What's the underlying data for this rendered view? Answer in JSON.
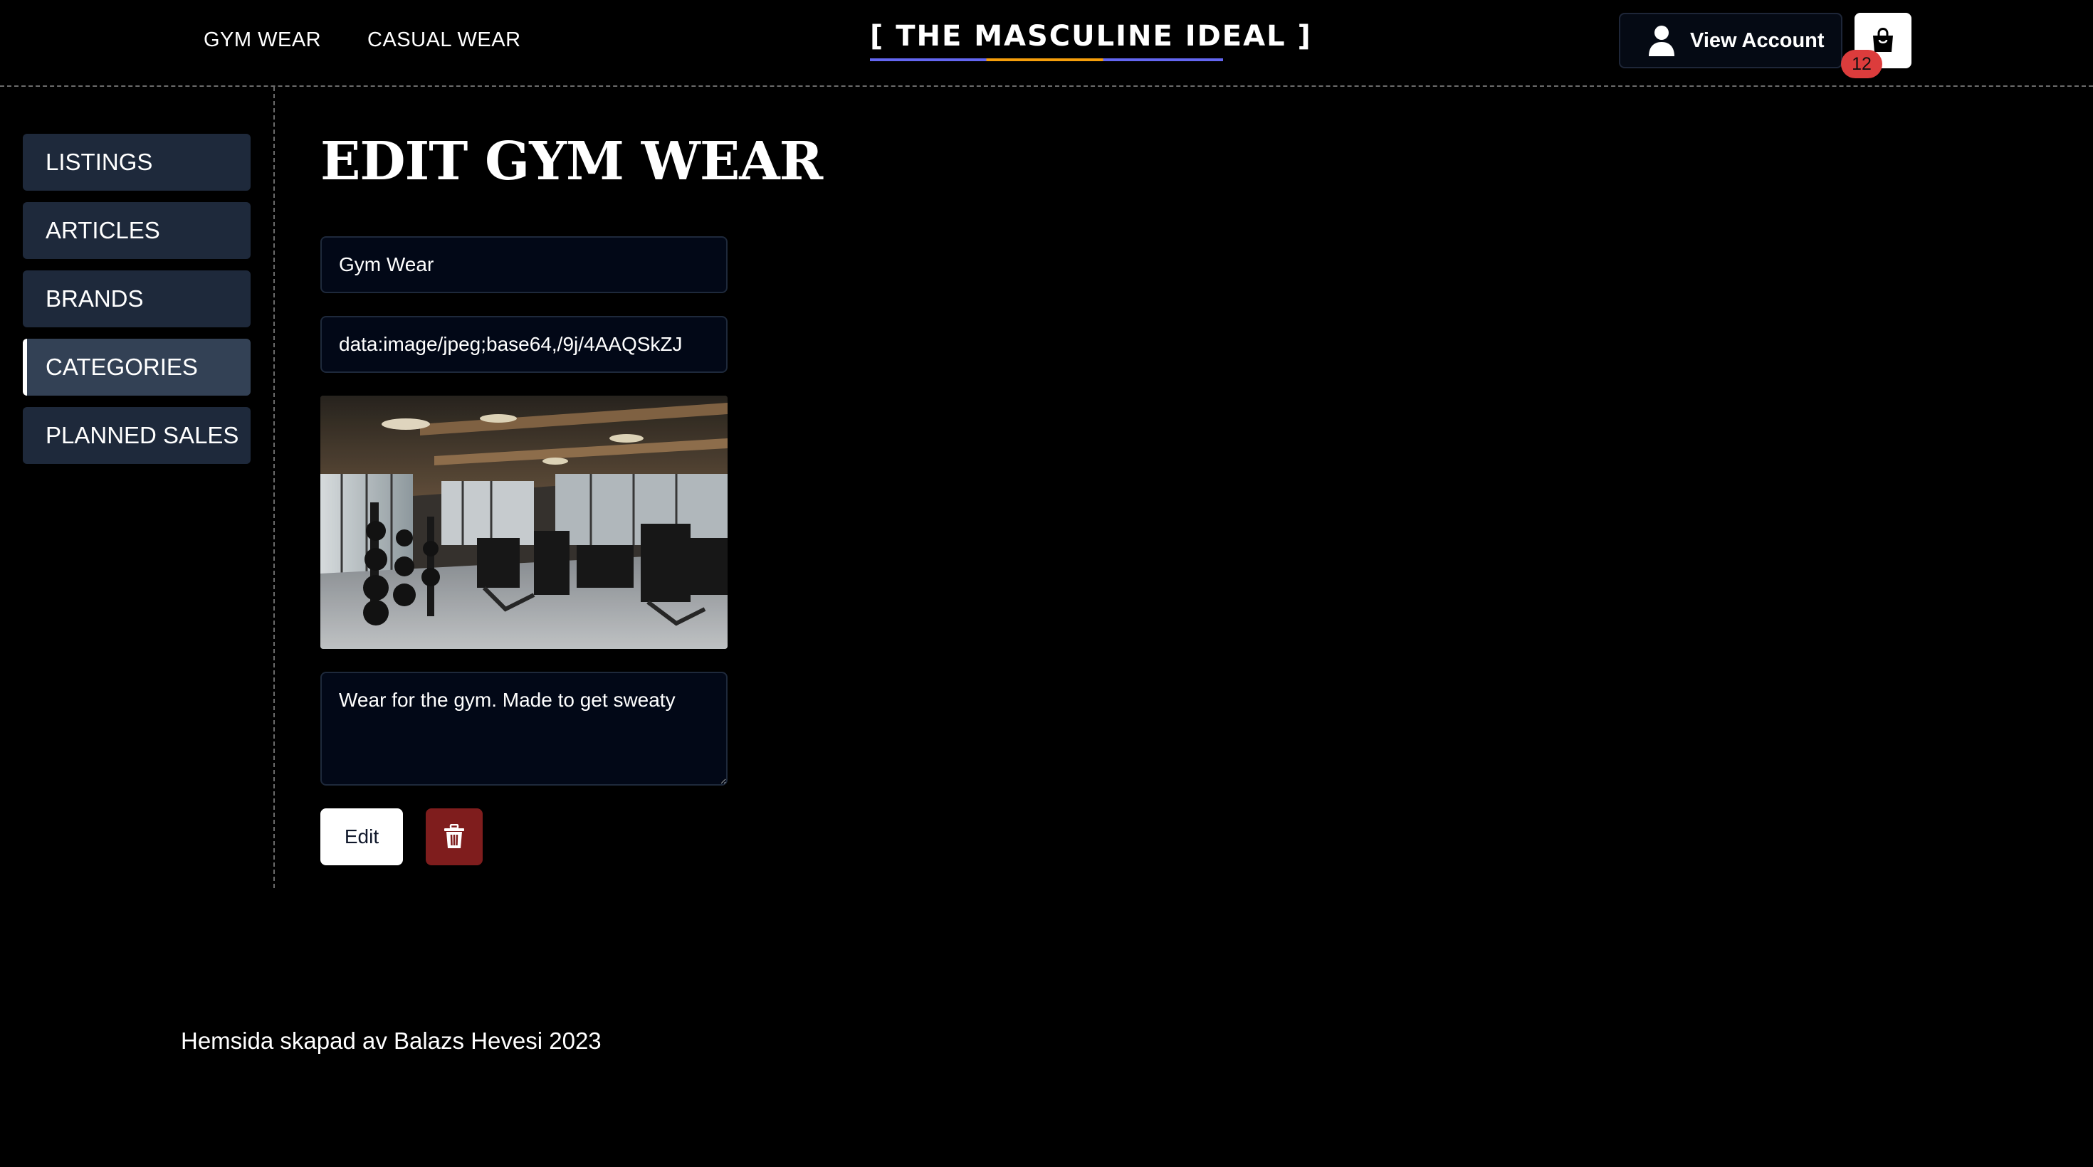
{
  "header": {
    "nav": [
      {
        "label": "GYM WEAR"
      },
      {
        "label": "CASUAL WEAR"
      }
    ],
    "logo": "[ THE MASCULINE IDEAL ]",
    "account_label": "View Account",
    "cart_count": "12",
    "icons": {
      "account": "user-icon",
      "cart": "shopping-bag-icon"
    }
  },
  "sidebar": {
    "items": [
      {
        "label": "LISTINGS"
      },
      {
        "label": "ARTICLES"
      },
      {
        "label": "BRANDS"
      },
      {
        "label": "CATEGORIES",
        "active": true
      },
      {
        "label": "PLANNED SALES"
      }
    ]
  },
  "main": {
    "title": "EDIT GYM WEAR",
    "name_value": "Gym Wear",
    "image_value": "data:image/jpeg;base64,/9j/4AAQSkZJ",
    "description_value": "Wear for the gym. Made to get sweaty",
    "edit_label": "Edit",
    "delete_icon": "trash-icon"
  },
  "footer": {
    "text": "Hemsida skapad av Balazs Hevesi 2023"
  },
  "colors": {
    "background": "#000000",
    "sidebar_item": "#1e293b",
    "sidebar_active": "#334155",
    "delete": "#7f1d1d",
    "badge": "#dc3c3c",
    "logo_underline_primary": "#6366f1",
    "logo_underline_accent": "#f59e0b"
  }
}
